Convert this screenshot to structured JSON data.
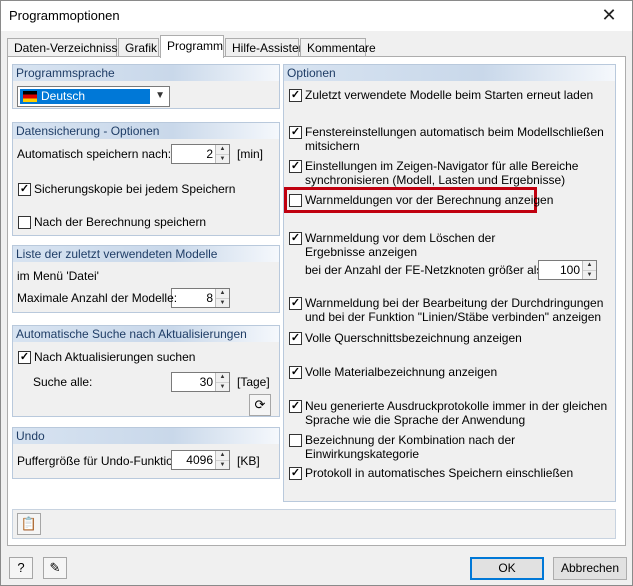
{
  "window": {
    "title": "Programmoptionen",
    "close_glyph": "✕"
  },
  "tabs": [
    {
      "label": "Daten-Verzeichnisse"
    },
    {
      "label": "Grafik"
    },
    {
      "label": "Programm"
    },
    {
      "label": "Hilfe-Assistent"
    },
    {
      "label": "Kommentare"
    }
  ],
  "active_tab": "Programm",
  "programmsprache": {
    "header": "Programmsprache",
    "selected": "Deutsch"
  },
  "datensicherung": {
    "header": "Datensicherung - Optionen",
    "autosave_label": "Automatisch speichern nach:",
    "autosave_value": "2",
    "autosave_unit": "[min]",
    "backup_label": "Sicherungskopie bei jedem Speichern",
    "backup_checked": true,
    "after_calc_label": "Nach der Berechnung speichern",
    "after_calc_checked": false
  },
  "recent": {
    "header": "Liste der zuletzt verwendeten Modelle",
    "menu_label": "im Menü 'Datei'",
    "max_label": "Maximale Anzahl der Modelle:",
    "max_value": "8"
  },
  "updates": {
    "header": "Automatische Suche nach Aktualisierungen",
    "search_label": "Nach Aktualisierungen suchen",
    "search_checked": true,
    "every_label": "Suche alle:",
    "every_value": "30",
    "every_unit": "[Tage]"
  },
  "undo": {
    "header": "Undo",
    "buffer_label": "Puffergröße für Undo-Funktion:",
    "buffer_value": "4096",
    "buffer_unit": "[KB]"
  },
  "optionen": {
    "header": "Optionen",
    "items": [
      {
        "text": "Zuletzt verwendete Modelle beim Starten erneut laden",
        "checked": true
      },
      {
        "text": "Fenstereinstellungen automatisch beim Modellschließen",
        "text2": "mitsichern",
        "checked": true
      },
      {
        "text": "Einstellungen im Zeigen-Navigator für alle Bereiche",
        "text2": "synchronisieren (Modell, Lasten und Ergebnisse)",
        "checked": true
      },
      {
        "text": "Warnmeldungen vor der Berechnung anzeigen",
        "checked": false
      },
      {
        "text": "Warnmeldung vor dem Löschen der",
        "text2": "Ergebnisse anzeigen",
        "checked": true
      },
      {
        "text": "Warnmeldung bei der Bearbeitung der Durchdringungen",
        "text2": "und bei der Funktion \"Linien/Stäbe verbinden\" anzeigen",
        "checked": true
      },
      {
        "text": "Volle Querschnittsbezeichnung anzeigen",
        "checked": true
      },
      {
        "text": "Volle Materialbezeichnung anzeigen",
        "checked": true
      },
      {
        "text": "Neu generierte Ausdruckprotokolle immer in der gleichen",
        "text2": "Sprache wie die Sprache der Anwendung",
        "checked": true
      },
      {
        "text": "Bezeichnung der Kombination nach der",
        "text2": "Einwirkungskategorie",
        "checked": false
      },
      {
        "text": "Protokoll in automatisches Speichern einschließen",
        "checked": true
      }
    ],
    "fe_nodes_label": "bei der Anzahl der FE-Netzknoten größer als:",
    "fe_nodes_value": "100"
  },
  "buttons": {
    "ok": "OK",
    "cancel": "Abbrechen"
  },
  "accent_highlight": "#c0000f",
  "check_glyph": "✓"
}
